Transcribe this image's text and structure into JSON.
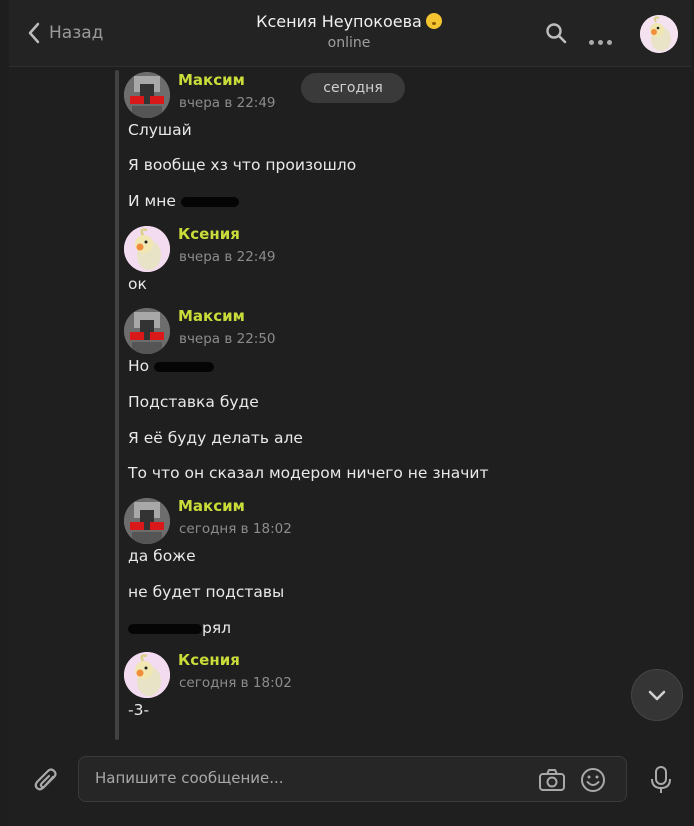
{
  "header": {
    "back_label": "Назад",
    "title": "Ксения Неупокоева",
    "status": "online"
  },
  "date_separator": "сегодня",
  "messages": [
    {
      "author": "Максим",
      "time": "вчера в 22:49"
    },
    {
      "author": "Ксения",
      "time": "вчера в 22:49"
    },
    {
      "author": "Максим",
      "time": "вчера в 22:50"
    },
    {
      "author": "Максим",
      "time": "сегодня в 18:02"
    },
    {
      "author": "Ксения",
      "time": "сегодня в 18:02"
    }
  ],
  "lines": {
    "m1_1": "Слушай",
    "m1_2": "Я вообще хз что произошло",
    "m1_3": "И мне",
    "m2_1": "ок",
    "m3_1": "Но",
    "m3_2": "Подставка буде",
    "m3_3": "Я её буду делать але",
    "m3_4": "То что он сказал модером ничего не значит",
    "m4_1": "да боже",
    "m4_2": "не будет подставы",
    "m4_3": "рял",
    "m5_1": "-3-"
  },
  "composer": {
    "placeholder": "Напишите сообщение..."
  },
  "icons": {
    "back": "chevron-left-icon",
    "search": "search-icon",
    "more": "more-horizontal-icon",
    "scroll": "chevron-down-icon",
    "attach": "paperclip-icon",
    "camera": "camera-icon",
    "emoji": "smile-icon",
    "mic": "microphone-icon"
  },
  "colors": {
    "author": "#c9dc3a",
    "background": "#1f1f1f",
    "pill": "#3a3a3a"
  }
}
